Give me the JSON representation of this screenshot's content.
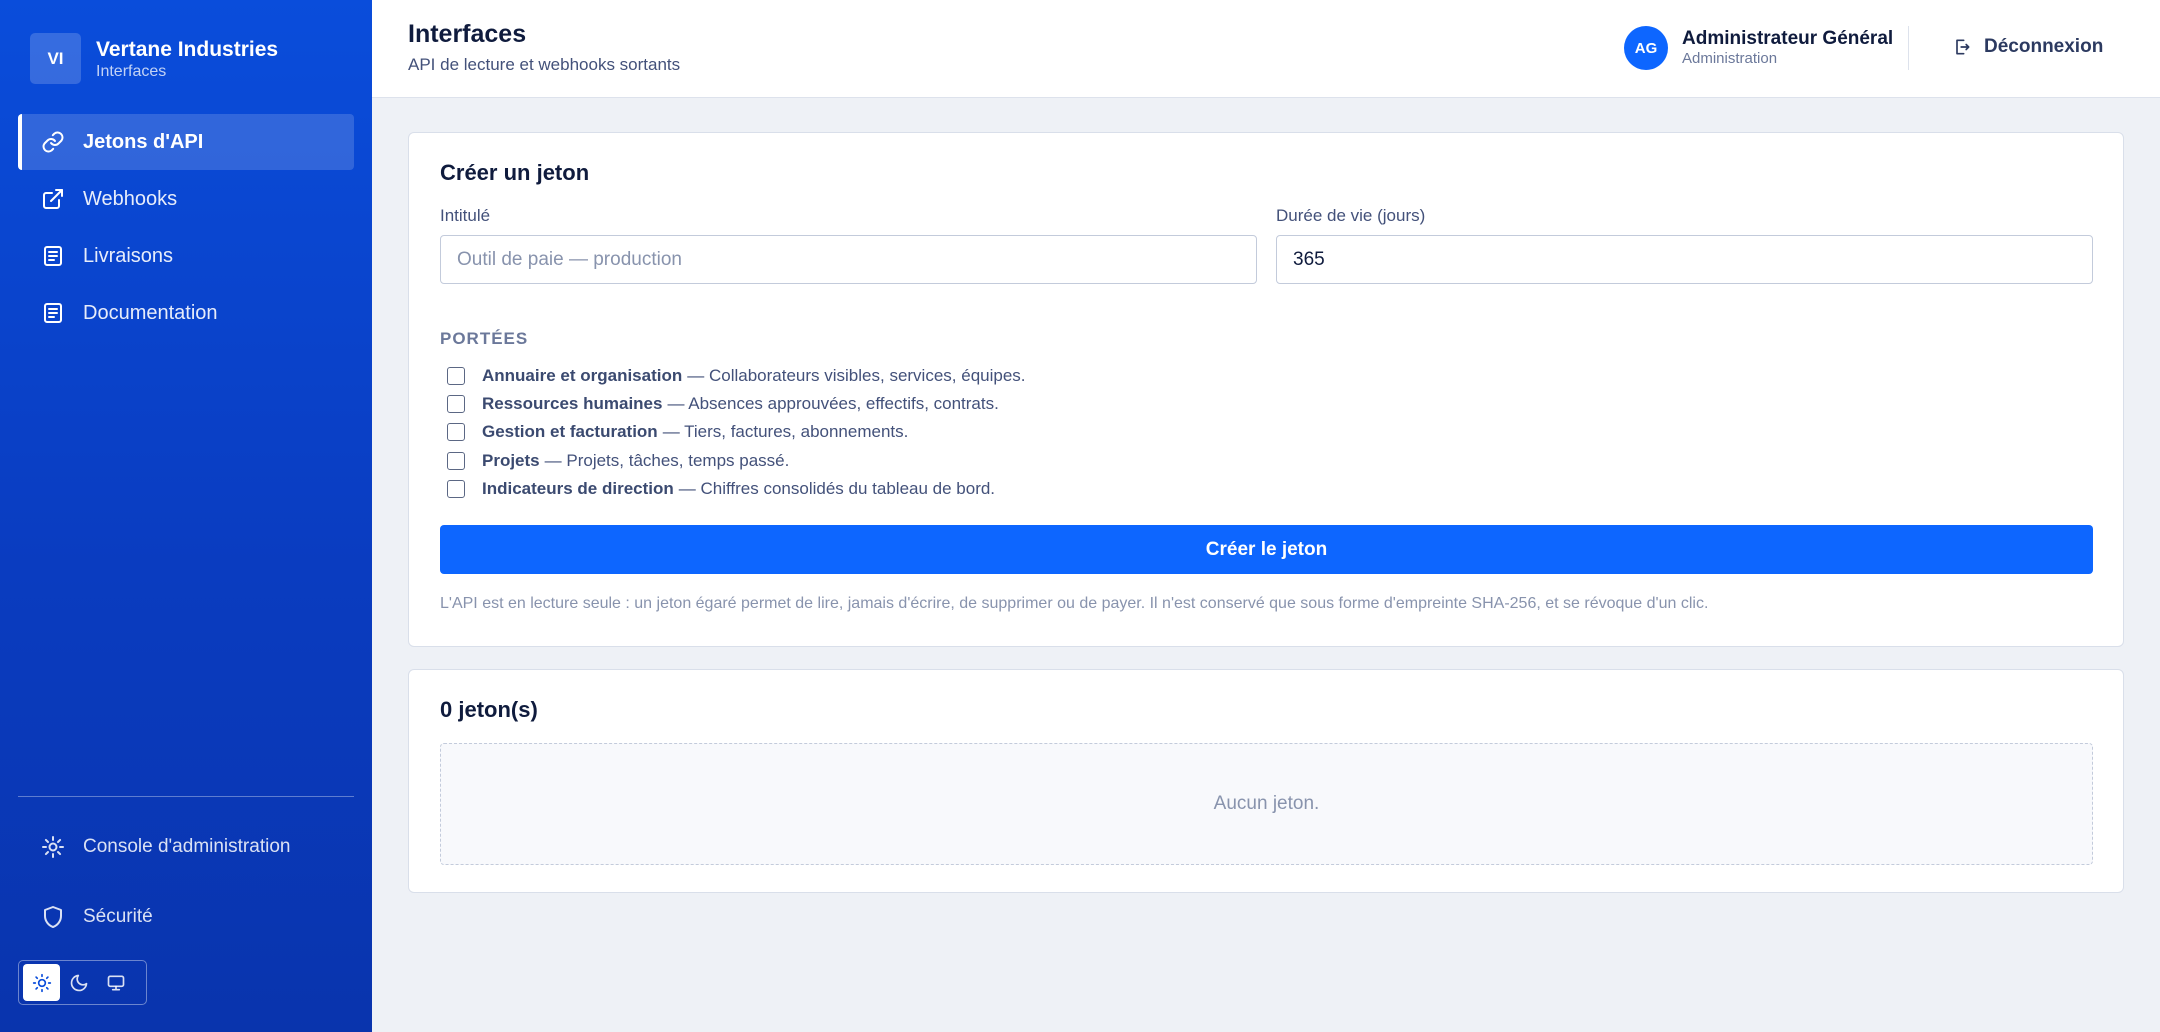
{
  "brand": {
    "logo": "VI",
    "name": "Vertane Industries",
    "subtitle": "Interfaces"
  },
  "nav": {
    "items": [
      {
        "label": "Jetons d'API",
        "icon": "link-icon",
        "active": true
      },
      {
        "label": "Webhooks",
        "icon": "external-link-icon",
        "active": false
      },
      {
        "label": "Livraisons",
        "icon": "list-icon",
        "active": false
      },
      {
        "label": "Documentation",
        "icon": "document-icon",
        "active": false
      }
    ],
    "bottom": [
      {
        "label": "Console d'administration",
        "icon": "gear-icon"
      },
      {
        "label": "Sécurité",
        "icon": "shield-icon"
      }
    ],
    "theme": {
      "options": [
        "sun-icon",
        "moon-icon",
        "monitor-icon"
      ],
      "selected": "sun-icon"
    }
  },
  "header": {
    "title": "Interfaces",
    "subtitle": "API de lecture et webhooks sortants",
    "user": {
      "initials": "AG",
      "name": "Administrateur Général",
      "role": "Administration"
    },
    "logout_label": "Déconnexion"
  },
  "create_form": {
    "title": "Créer un jeton",
    "label_field": {
      "label": "Intitulé",
      "placeholder": "Outil de paie — production",
      "value": ""
    },
    "lifetime_field": {
      "label": "Durée de vie (jours)",
      "value": "365"
    },
    "scopes_title": "PORTÉES",
    "scopes": [
      {
        "name": "Annuaire et organisation",
        "desc": "— Collaborateurs visibles, services, équipes.",
        "checked": false
      },
      {
        "name": "Ressources humaines",
        "desc": "— Absences approuvées, effectifs, contrats.",
        "checked": false
      },
      {
        "name": "Gestion et facturation",
        "desc": "— Tiers, factures, abonnements.",
        "checked": false
      },
      {
        "name": "Projets",
        "desc": "— Projets, tâches, temps passé.",
        "checked": false
      },
      {
        "name": "Indicateurs de direction",
        "desc": "— Chiffres consolidés du tableau de bord.",
        "checked": false
      }
    ],
    "submit_label": "Créer le jeton",
    "note": "L'API est en lecture seule : un jeton égaré permet de lire, jamais d'écrire, de supprimer ou de payer. Il n'est conservé que sous forme d'empreinte SHA-256, et se révoque d'un clic."
  },
  "tokens": {
    "title": "0 jeton(s)",
    "empty_text": "Aucun jeton."
  },
  "colors": {
    "sidebar": "#0a4ddb",
    "accent": "#0d66ff",
    "background": "#eef1f6"
  }
}
